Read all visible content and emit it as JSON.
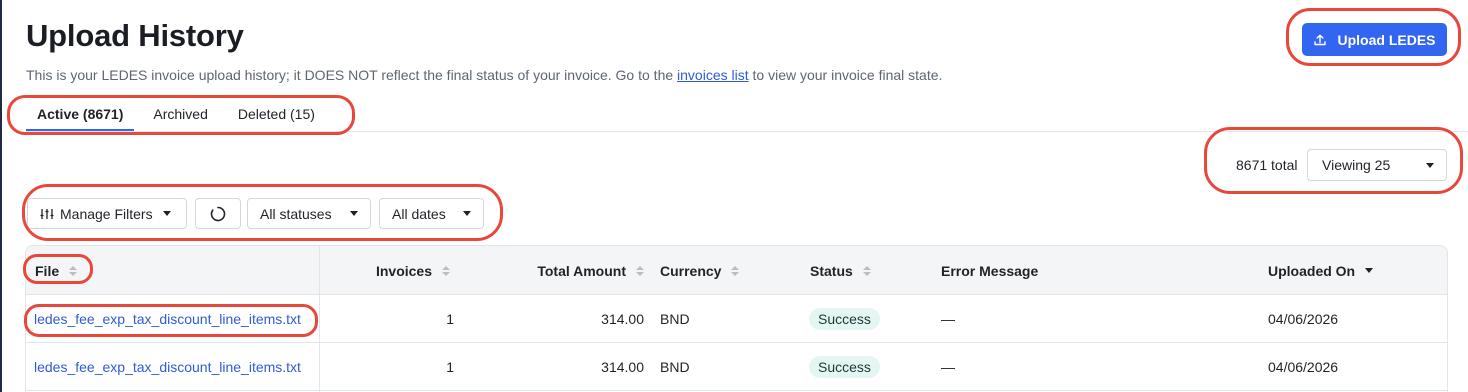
{
  "page": {
    "title": "Upload History",
    "subtitle_before": "This is your LEDES invoice upload history; it DOES NOT reflect the final status of your invoice. Go to the",
    "subtitle_link": "invoices list",
    "subtitle_after": "to view your invoice final state.",
    "upload_button": "Upload LEDES"
  },
  "tabs": [
    {
      "label": "Active (8671)",
      "active": true
    },
    {
      "label": "Archived",
      "active": false
    },
    {
      "label": "Deleted (15)",
      "active": false
    }
  ],
  "pagination": {
    "total": "8671 total",
    "viewing": "Viewing 25"
  },
  "toolbar": {
    "manage_filters": "Manage Filters",
    "status_filter": "All statuses",
    "date_filter": "All dates"
  },
  "table": {
    "headers": {
      "file": "File",
      "invoices": "Invoices",
      "total_amount": "Total Amount",
      "currency": "Currency",
      "status": "Status",
      "error_message": "Error Message",
      "uploaded_on": "Uploaded On"
    },
    "rows": [
      {
        "file": "ledes_fee_exp_tax_discount_line_items.txt",
        "invoices": "1",
        "total_amount": "314.00",
        "currency": "BND",
        "status": "Success",
        "error_message": "—",
        "uploaded_on": "04/06/2026"
      },
      {
        "file": "ledes_fee_exp_tax_discount_line_items.txt",
        "invoices": "1",
        "total_amount": "314.00",
        "currency": "BND",
        "status": "Success",
        "error_message": "—",
        "uploaded_on": "04/06/2026"
      }
    ]
  },
  "colors": {
    "accent": "#3366f0",
    "link": "#2f5bd8",
    "success_badge_bg": "#e3f6f2",
    "annotation_ring": "#e8473b"
  }
}
